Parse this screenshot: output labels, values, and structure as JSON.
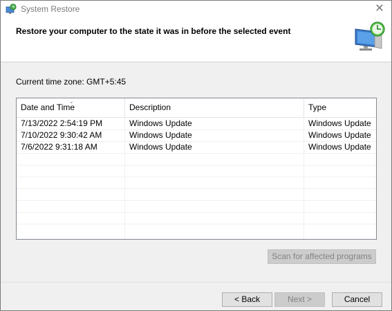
{
  "window": {
    "title": "System Restore",
    "close_glyph": "✕",
    "app_icon": "system-restore-icon"
  },
  "header": {
    "heading": "Restore your computer to the state it was in before the selected event",
    "icon": "computer-restore-clock-icon"
  },
  "timezone": {
    "label": "Current time zone: GMT+5:45"
  },
  "list": {
    "sort_indicator": "⌄",
    "columns": [
      "Date and Time",
      "Description",
      "Type"
    ],
    "rows": [
      [
        "7/13/2022 2:54:19 PM",
        "Windows Update",
        "Windows Update"
      ],
      [
        "7/10/2022 9:30:42 AM",
        "Windows Update",
        "Windows Update"
      ],
      [
        "7/6/2022 9:31:18 AM",
        "Windows Update",
        "Windows Update"
      ]
    ]
  },
  "buttons": {
    "scan": "Scan for affected programs",
    "back": "< Back",
    "next": "Next >",
    "cancel": "Cancel"
  }
}
